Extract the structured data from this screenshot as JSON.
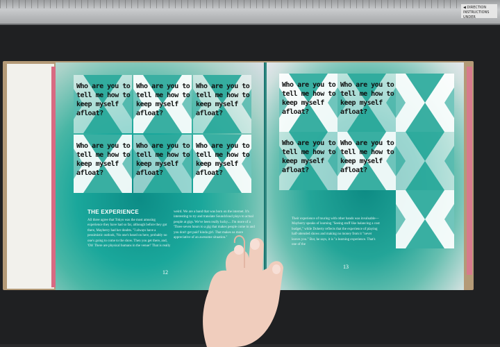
{
  "ruler": {
    "label_line1": "◀ DIRECTION",
    "label_line2": "INSTRUCTIONS UNDER"
  },
  "tile_text": "Who are you to\ntell me how to\nkeep myself\nafloat?",
  "left_page": {
    "heading": "THE EXPERIENCE",
    "col1": "All three agree that Tokyo was the most amusing experience they have had so far, although before they got there, Mayberry had her doubts. \"I always have a pessimistic outlook, 'No one's heard on here, probably no one's going to come to the show. Then you get there, and, 'Oh! There are physical humans in the venue!' That is really",
    "col2": "weird. We are a band that was born on the internet. It's interesting to try and translate Soundcloud plays to actual people at gigs. We've been really lucky.... I'm more of a 'Three seven hours to a gig that makes people come to and you don't get paid' kinda girl. That makes us more appreciative of an awesome situation.\"",
    "page_number": "12"
  },
  "right_page": {
    "col1": "Their experience of touring with other bands was invaluable—Mayberry speaks of learning \"Seeing stuff like balancing a cost budget,\" while Doherty reflects that the experience of playing half-attended shows and making no money from it \"never leaves you.\" But, he says, it is \"a learning experience. That's one of the",
    "page_number": "13"
  }
}
